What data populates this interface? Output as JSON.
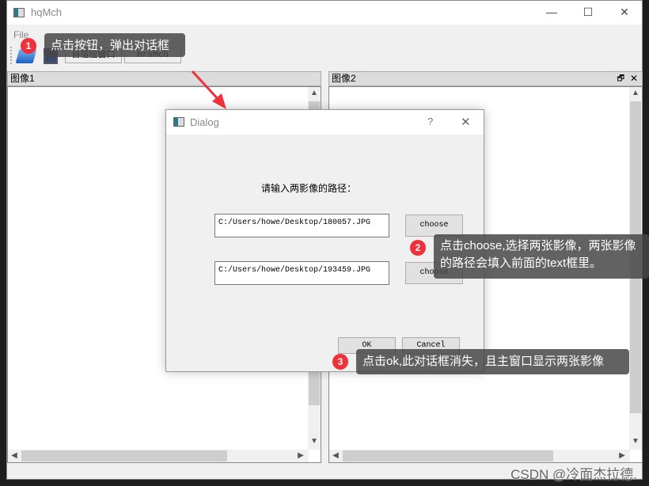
{
  "window": {
    "title": "hqMch",
    "menu": [
      "File"
    ],
    "minimize": "—",
    "maximize": "☐",
    "close": "✕"
  },
  "toolbar": {
    "buttons": [
      "自适应窗口",
      "hrsMch"
    ],
    "icons": [
      "open-folder-icon",
      "save-icon"
    ]
  },
  "docks": [
    {
      "title": "图像1"
    },
    {
      "title": "图像2",
      "float": "🗗",
      "close": "✕"
    }
  ],
  "dialog": {
    "title": "Dialog",
    "help": "?",
    "close": "✕",
    "prompt": "请输入两影像的路径：",
    "path1": "C:/Users/howe/Desktop/180057.JPG",
    "path2": "C:/Users/howe/Desktop/193459.JPG",
    "choose": "choose",
    "ok": "OK",
    "cancel": "Cancel"
  },
  "annotations": [
    {
      "num": "1",
      "text": "点击按钮，弹出对话框"
    },
    {
      "num": "2",
      "text": "点击choose,选择两张影像，两张影像的路径会填入前面的text框里。"
    },
    {
      "num": "3",
      "text": "点击ok,此对话框消失，且主窗口显示两张影像"
    }
  ],
  "watermark": "CSDN @冷面杰拉德.",
  "colors": {
    "badge": "#f0303a",
    "arrow": "#f0303a",
    "callout": "#464646"
  }
}
